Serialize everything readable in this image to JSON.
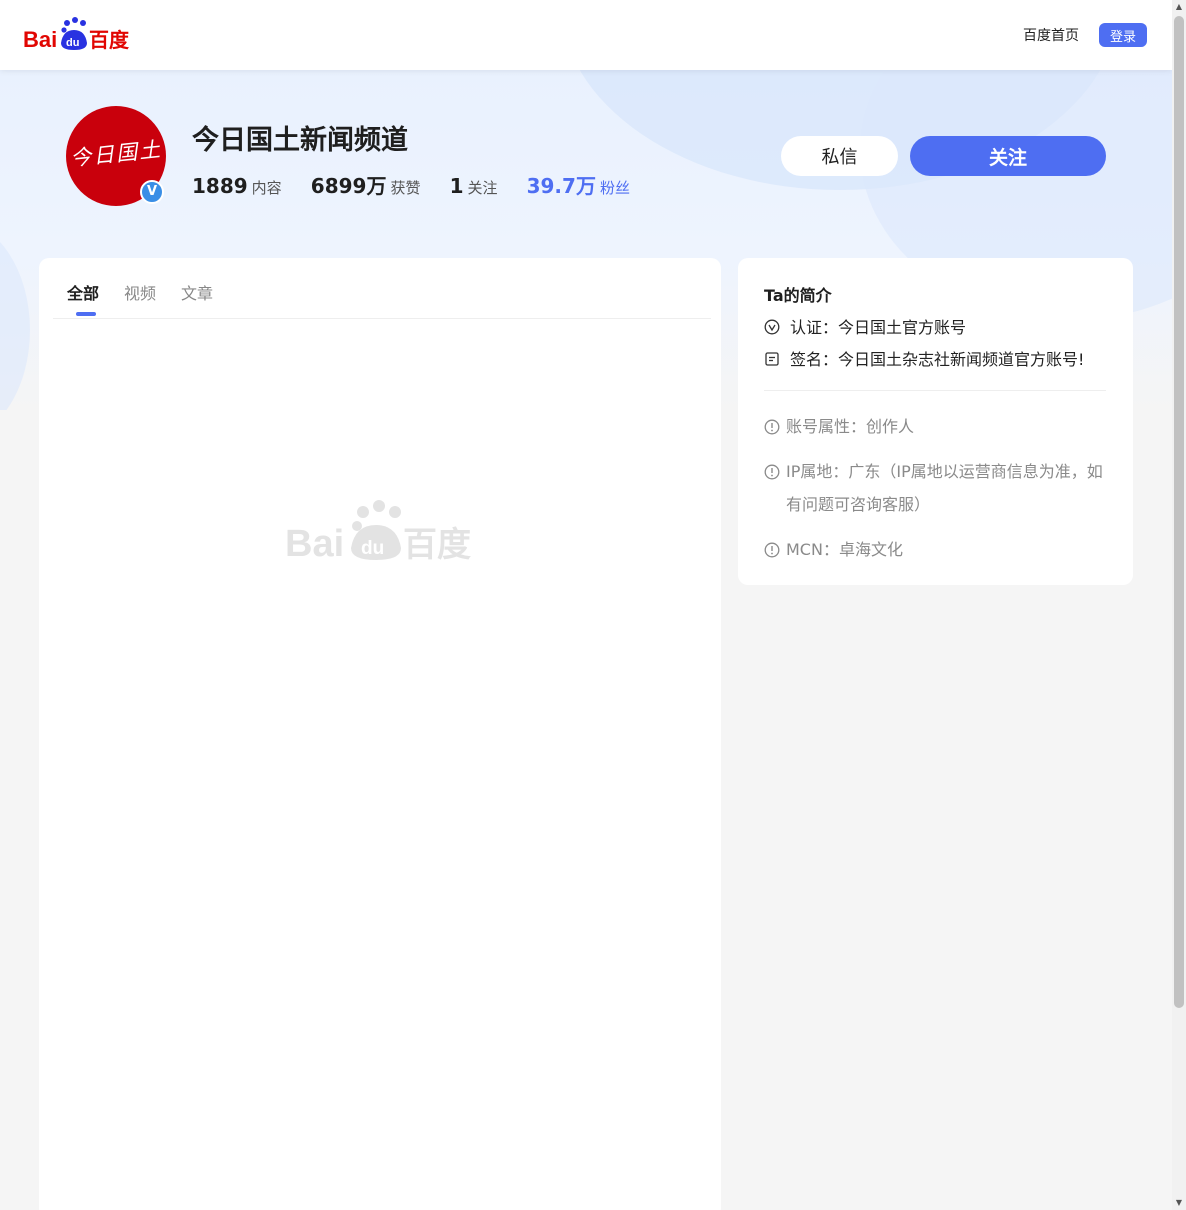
{
  "header": {
    "logo_text": "Bai百度",
    "home_link": "百度首页",
    "login_label": "登录"
  },
  "profile": {
    "avatar_text": "今日国土",
    "verified_mark": "V",
    "name": "今日国土新闻频道",
    "stats": [
      {
        "value": "1889",
        "label": "内容"
      },
      {
        "value": "6899万",
        "label": "获赞"
      },
      {
        "value": "1",
        "label": "关注"
      },
      {
        "value": "39.7万",
        "label": "粉丝"
      }
    ],
    "message_label": "私信",
    "follow_label": "关注"
  },
  "tabs": [
    {
      "label": "全部",
      "active": true
    },
    {
      "label": "视频",
      "active": false
    },
    {
      "label": "文章",
      "active": false
    }
  ],
  "intro": {
    "title": "Ta的简介",
    "certification": "认证：今日国土官方账号",
    "signature": "签名：今日国土杂志社新闻频道官方账号!",
    "account_type": "账号属性：创作人",
    "ip_location": "IP属地：广东（IP属地以运营商信息为准，如有问题可咨询客服）",
    "mcn": "MCN：卓海文化"
  },
  "colors": {
    "accent": "#4e6ef2",
    "avatar_bg": "#c9000c",
    "logo_red": "#e10602",
    "logo_blue": "#2932e1"
  },
  "icons": [
    "baidu-logo",
    "verified-badge-icon",
    "certification-icon",
    "signature-icon",
    "info-icon"
  ]
}
